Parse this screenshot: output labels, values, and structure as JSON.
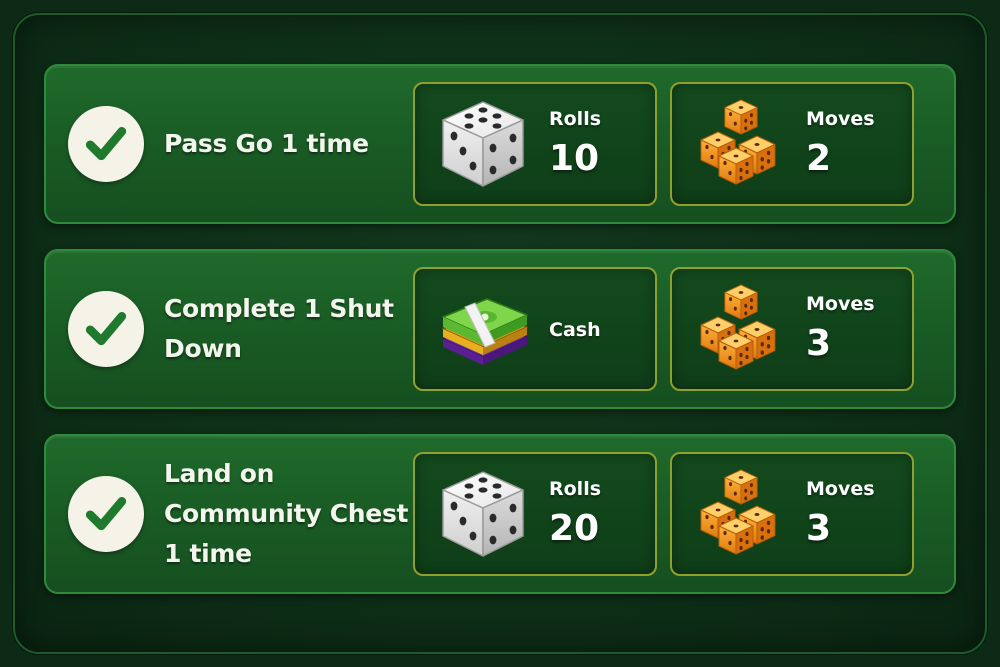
{
  "quests": [
    {
      "title": "Pass Go 1 time",
      "completed": true,
      "rewards": [
        {
          "icon": "die-icon",
          "label": "Rolls",
          "value": "10"
        },
        {
          "icon": "orange-dice-stack-icon",
          "label": "Moves",
          "value": "2"
        }
      ]
    },
    {
      "title": "Complete 1 Shut Down",
      "completed": true,
      "rewards": [
        {
          "icon": "cash-stack-icon",
          "label": "Cash",
          "value": ""
        },
        {
          "icon": "orange-dice-stack-icon",
          "label": "Moves",
          "value": "3"
        }
      ]
    },
    {
      "title": "Land on Community Chest 1 time",
      "completed": true,
      "rewards": [
        {
          "icon": "die-icon",
          "label": "Rolls",
          "value": "20"
        },
        {
          "icon": "orange-dice-stack-icon",
          "label": "Moves",
          "value": "3"
        }
      ]
    }
  ],
  "colors": {
    "check": "#1f7a2e",
    "card_border": "#8fa02f",
    "row_background": "#1b5f26",
    "panel_background": "#0f321a"
  }
}
